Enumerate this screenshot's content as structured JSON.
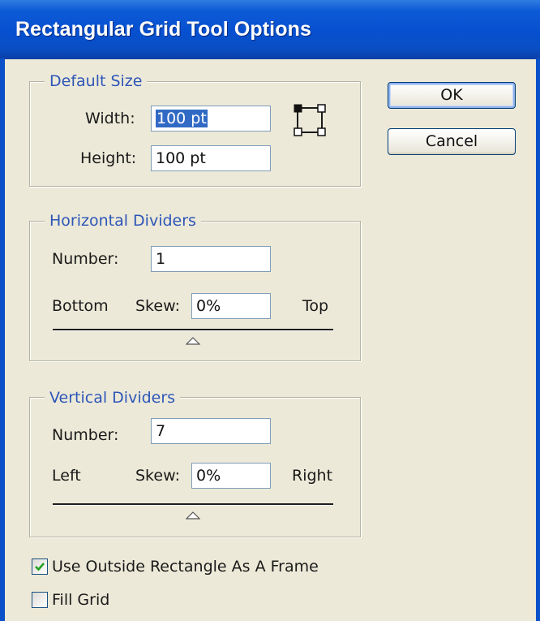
{
  "window": {
    "title": "Rectangular Grid Tool Options"
  },
  "default_size": {
    "legend": "Default Size",
    "width_label": "Width:",
    "width_value": "100 pt",
    "height_label": "Height:",
    "height_value": "100 pt",
    "reference_point_icon": "reference-point-icon"
  },
  "horizontal_dividers": {
    "legend": "Horizontal Dividers",
    "number_label": "Number:",
    "number_value": "1",
    "left_end_label": "Bottom",
    "skew_label": "Skew:",
    "skew_value": "0%",
    "right_end_label": "Top",
    "slider_position": 0.5
  },
  "vertical_dividers": {
    "legend": "Vertical Dividers",
    "number_label": "Number:",
    "number_value": "7",
    "left_end_label": "Left",
    "skew_label": "Skew:",
    "skew_value": "0%",
    "right_end_label": "Right",
    "slider_position": 0.5
  },
  "buttons": {
    "ok": "OK",
    "cancel": "Cancel"
  },
  "options": {
    "use_outside_rect": {
      "label": "Use Outside Rectangle As A Frame",
      "checked": true
    },
    "fill_grid": {
      "label": "Fill Grid",
      "checked": false
    }
  },
  "colors": {
    "titlebar": "#0650d0",
    "legend_text": "#2e56b8",
    "dialog_bg": "#ece9d8",
    "selection": "#316ac5"
  }
}
